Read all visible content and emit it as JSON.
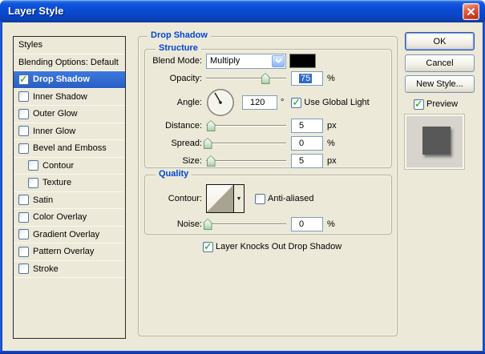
{
  "window": {
    "title": "Layer Style"
  },
  "icons": {
    "close": "x-close",
    "check": "✓",
    "dropdown_arrow": "▼",
    "combo_chevron": "chevron-down"
  },
  "colors": {
    "titlebar_blue": "#0a4ad2",
    "frame_blue": "#0d3ec0",
    "selection_blue": "#316ac5",
    "group_label_blue": "#0046d5",
    "check_green": "#18a318",
    "dialog_bg": "#ece9d8",
    "blend_swatch": "#000000"
  },
  "sidebar": {
    "items": [
      {
        "label": "Styles",
        "checkbox": false,
        "checked": false,
        "selected": false,
        "indent": false
      },
      {
        "label": "Blending Options: Default",
        "checkbox": false,
        "checked": false,
        "selected": false,
        "indent": false
      },
      {
        "label": "Drop Shadow",
        "checkbox": true,
        "checked": true,
        "selected": true,
        "indent": false
      },
      {
        "label": "Inner Shadow",
        "checkbox": true,
        "checked": false,
        "selected": false,
        "indent": false
      },
      {
        "label": "Outer Glow",
        "checkbox": true,
        "checked": false,
        "selected": false,
        "indent": false
      },
      {
        "label": "Inner Glow",
        "checkbox": true,
        "checked": false,
        "selected": false,
        "indent": false
      },
      {
        "label": "Bevel and Emboss",
        "checkbox": true,
        "checked": false,
        "selected": false,
        "indent": false
      },
      {
        "label": "Contour",
        "checkbox": true,
        "checked": false,
        "selected": false,
        "indent": true
      },
      {
        "label": "Texture",
        "checkbox": true,
        "checked": false,
        "selected": false,
        "indent": true
      },
      {
        "label": "Satin",
        "checkbox": true,
        "checked": false,
        "selected": false,
        "indent": false
      },
      {
        "label": "Color Overlay",
        "checkbox": true,
        "checked": false,
        "selected": false,
        "indent": false
      },
      {
        "label": "Gradient Overlay",
        "checkbox": true,
        "checked": false,
        "selected": false,
        "indent": false
      },
      {
        "label": "Pattern Overlay",
        "checkbox": true,
        "checked": false,
        "selected": false,
        "indent": false
      },
      {
        "label": "Stroke",
        "checkbox": true,
        "checked": false,
        "selected": false,
        "indent": false
      }
    ]
  },
  "panel": {
    "title": "Drop Shadow",
    "structure": {
      "title": "Structure",
      "blend_mode": {
        "label": "Blend Mode:",
        "value": "Multiply",
        "swatch_color": "#000000"
      },
      "opacity": {
        "label": "Opacity:",
        "value": "75",
        "unit": "%",
        "thumb_pct": 74,
        "value_selected": true
      },
      "angle": {
        "label": "Angle:",
        "value": "120",
        "unit": "°"
      },
      "use_global_light": {
        "label": "Use Global Light",
        "checked": true
      },
      "distance": {
        "label": "Distance:",
        "value": "5",
        "unit": "px",
        "thumb_pct": 6
      },
      "spread": {
        "label": "Spread:",
        "value": "0",
        "unit": "%",
        "thumb_pct": 2
      },
      "size": {
        "label": "Size:",
        "value": "5",
        "unit": "px",
        "thumb_pct": 6
      }
    },
    "quality": {
      "title": "Quality",
      "contour": {
        "label": "Contour:",
        "preview": "linear-ramp"
      },
      "anti_aliased": {
        "label": "Anti-aliased",
        "checked": false
      },
      "noise": {
        "label": "Noise:",
        "value": "0",
        "unit": "%",
        "thumb_pct": 2
      }
    },
    "knockout": {
      "label": "Layer Knocks Out Drop Shadow",
      "checked": true
    }
  },
  "actions": {
    "ok": "OK",
    "cancel": "Cancel",
    "new_style": "New Style...",
    "preview": {
      "label": "Preview",
      "checked": true
    }
  }
}
